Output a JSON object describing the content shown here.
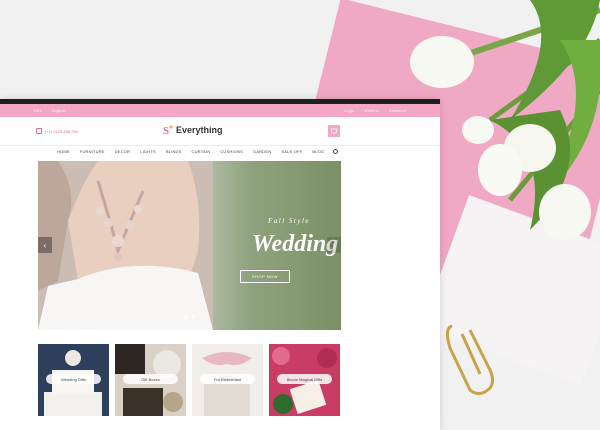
{
  "top_strip": {
    "left_items": [
      "USD",
      "English"
    ],
    "right_items": [
      "Login",
      "Wishlist",
      "Checkout"
    ]
  },
  "header": {
    "phone": "(+1) 0123 456 789",
    "logo_text": "Everything"
  },
  "nav": {
    "items": [
      "HOME",
      "FURNITURE",
      "DECOR",
      "LIGHTS",
      "BLINDS",
      "CURTAIN",
      "CUSHIONS",
      "GARDEN",
      "SALE OFF",
      "BLOG"
    ]
  },
  "hero": {
    "subtitle": "Fall Style",
    "title": "Wedding",
    "button": "SHOP NOW",
    "prev": "‹",
    "next": "›"
  },
  "tiles": [
    {
      "label": "Wedding Gifts"
    },
    {
      "label": "Gift Boxes"
    },
    {
      "label": "For Bridesmaid"
    },
    {
      "label": "Bloom Magical Gifts"
    }
  ],
  "colors": {
    "accent": "#f4a6c6",
    "accent_dark": "#e26a9c"
  }
}
